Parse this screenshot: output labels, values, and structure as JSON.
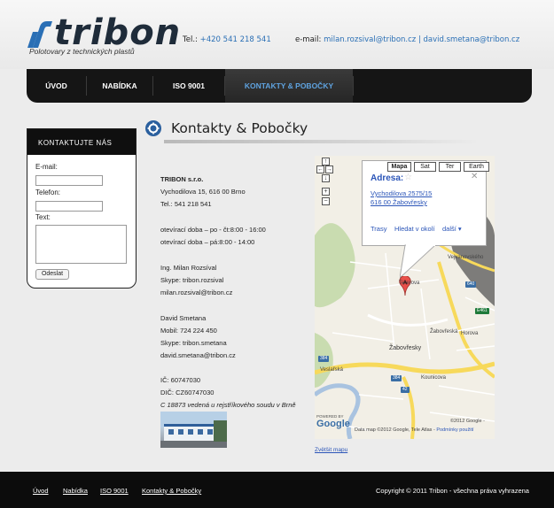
{
  "header": {
    "logo_word": "tribon",
    "logo_tagline": "Polotovary z technických plastů",
    "tel_label": "Tel.:",
    "tel_value": "+420 541 218 541",
    "email_label": "e-mail:",
    "email_value": "milan.rozsival@tribon.cz | david.smetana@tribon.cz"
  },
  "nav": {
    "items": [
      {
        "label": "ÚVOD"
      },
      {
        "label": "NABÍDKA"
      },
      {
        "label": "ISO 9001"
      },
      {
        "label": "KONTAKTY & POBOČKY",
        "active": true
      }
    ]
  },
  "sidebar": {
    "heading": "KONTAKTUJTE NÁS",
    "email_label": "E-mail:",
    "phone_label": "Telefon:",
    "text_label": "Text:",
    "send_label": "Odeslat"
  },
  "main": {
    "title": "Kontakty & Pobočky",
    "company": "TRIBON s.r.o.",
    "address": "Vychodilova 15, 616 00 Brno",
    "tel": "Tel.: 541 218 541",
    "hours_weekdays": "otevírací doba – po - čt:8:00 - 16:00",
    "hours_friday": "otevírací doba – pá:8:00 - 14:00",
    "person1_name": "Ing. Milan Rozsíval",
    "person1_skype": "Skype: tribon.rozsival",
    "person1_email": "milan.rozsival@tribon.cz",
    "person2_name": "David Smetana",
    "person2_mobile": "Mobil: 724 224 450",
    "person2_skype": "Skype: tribon.smetana",
    "person2_email": "david.smetana@tribon.cz",
    "ic": "IČ: 60747030",
    "dic": "DIČ: CZ60747030",
    "registry": "C 18873 vedená u rejstříkového soudu v Brně"
  },
  "map": {
    "types": [
      "Mapa",
      "Sat",
      "Ter",
      "Earth"
    ],
    "active_type": "Mapa",
    "bubble_title": "Adresa:",
    "bubble_addr1": "Vychodilova 2575/15",
    "bubble_addr2": "616 00 Žabovřesky",
    "link_routes": "Trasy",
    "link_nearby": "Hledat v okolí",
    "link_more": "další",
    "place_label": "Žabovřesky",
    "road_label_1": "Vejvanovského",
    "road_label_2": "Žabovřeská",
    "road_label_3": "Horova",
    "road_label_4": "Veslařská",
    "road_label_5": "Kounicova",
    "road_label_6": "Tererova",
    "shield_1": "640",
    "shield_2": "E461",
    "shield_3": "384",
    "shield_4": "42",
    "powered_by": "POWERED BY",
    "google_logo": "Google",
    "copyright_google": "©2012 Google -",
    "data_notice": "Data map ©2012 Google, Tele Atlas - ",
    "terms_link": "Podmínky použití",
    "bigger_map": "Zvětšit mapu"
  },
  "footer": {
    "links": [
      "Úvod",
      "Nabídka",
      "ISO 9001",
      "Kontakty & Pobočky"
    ],
    "copyright": "Copyright © 2011 Tribon - všechna práva vyhrazena"
  },
  "colors": {
    "accent_blue": "#2a6fb5",
    "nav_bg": "#151515",
    "nav_active_text": "#5fa3e0",
    "footer_bg": "#0c0c0c"
  },
  "icons": [
    "logo-mark-icon",
    "gear-icon",
    "star-icon",
    "close-icon",
    "map-pin-icon"
  ]
}
